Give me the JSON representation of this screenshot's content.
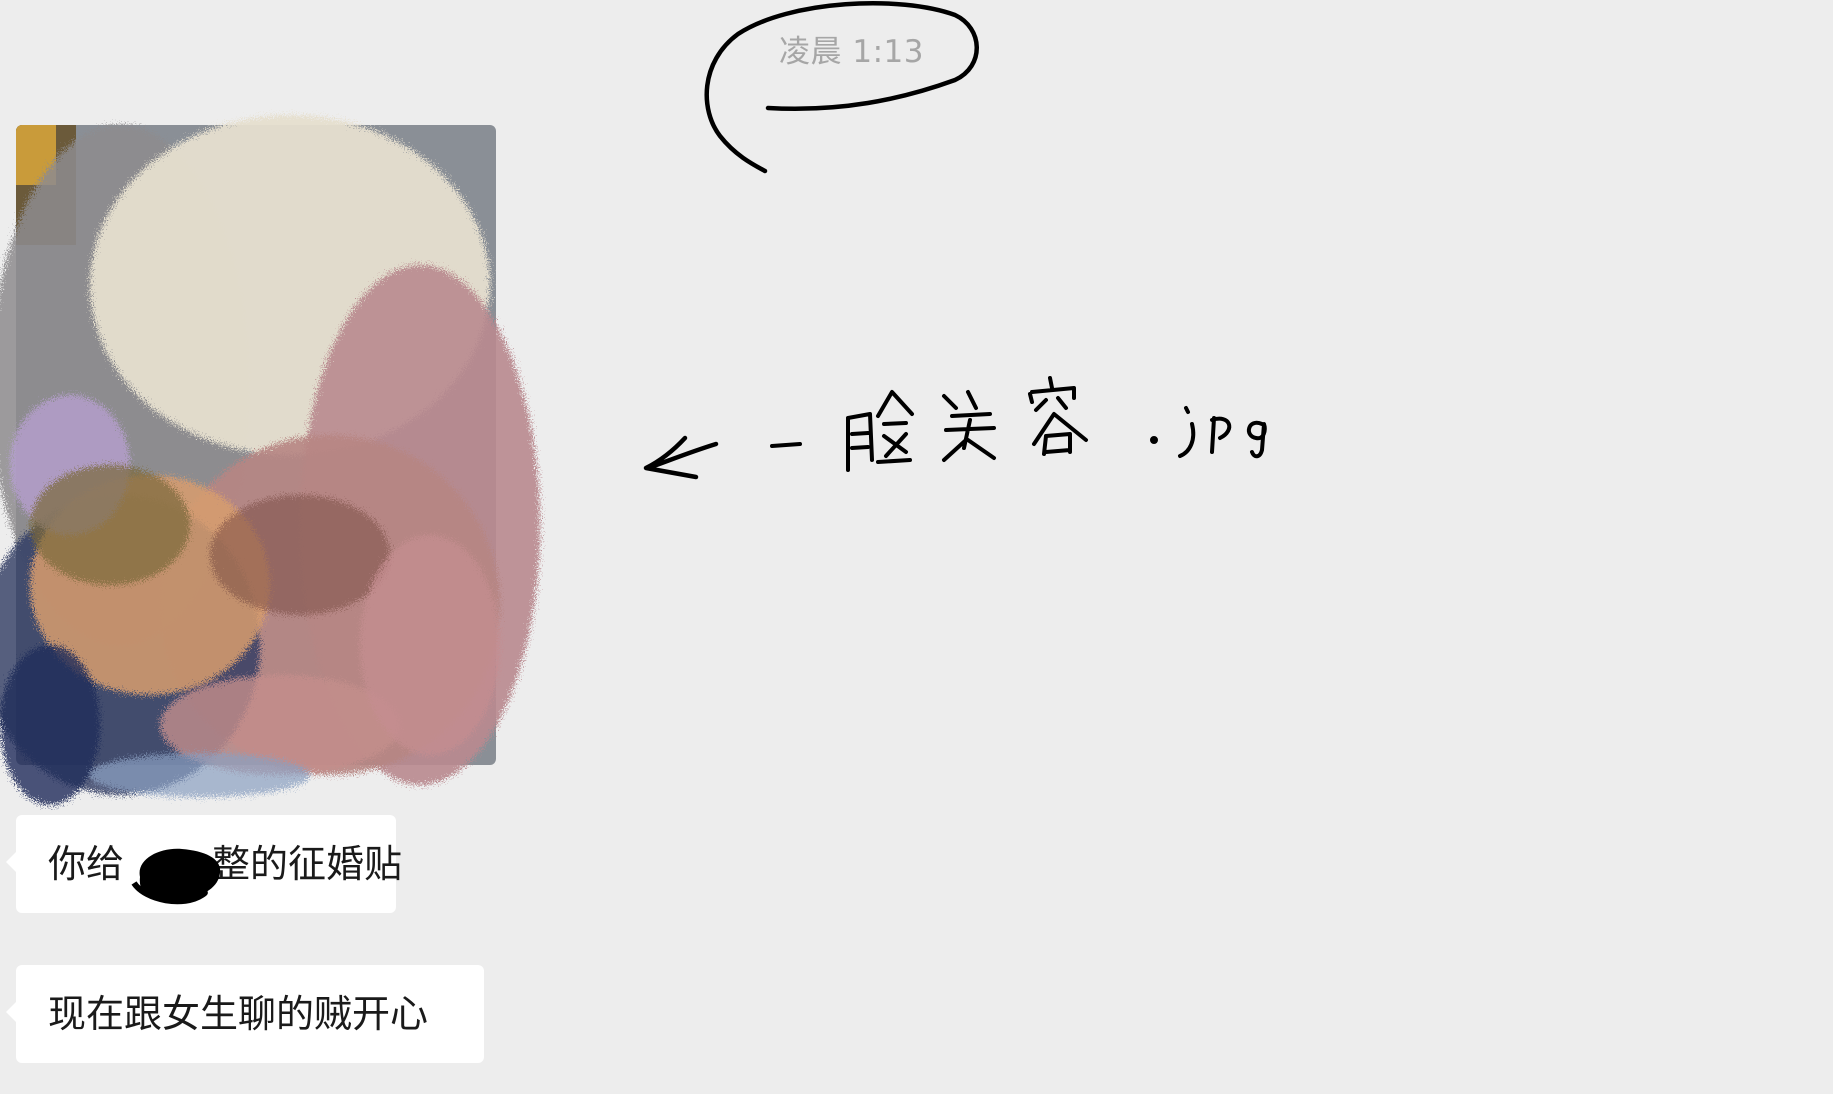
{
  "chat": {
    "timestamp": "凌晨 1:13",
    "messages": [
      {
        "type": "image",
        "alt": ""
      },
      {
        "type": "text",
        "parts": [
          "你给",
          "整的征婚贴"
        ]
      },
      {
        "type": "text",
        "text": "现在跟女生聊的贼开心"
      }
    ]
  },
  "annotation": {
    "handwritten_text": "← 一脸笑容 .jpg",
    "stroke_color": "#000000"
  },
  "colors": {
    "background": "#ededed",
    "bubble": "#ffffff",
    "timestamp": "#a6a6a6",
    "text": "#1a1a1a"
  }
}
